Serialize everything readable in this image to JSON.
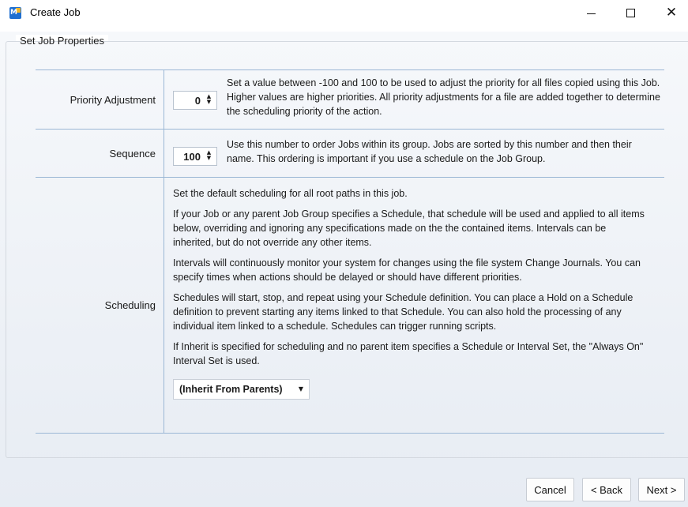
{
  "window": {
    "title": "Create Job",
    "minimize_symbol": "",
    "close_symbol": "✕"
  },
  "group": {
    "title": "Set Job Properties"
  },
  "properties": {
    "priority": {
      "label": "Priority Adjustment",
      "value": "0",
      "description": "Set a value between -100 and 100 to be used to adjust the priority for all files copied using this Job. Higher values are higher priorities. All priority adjustments for a file are added together to determine the scheduling priority of the action."
    },
    "sequence": {
      "label": "Sequence",
      "value": "100",
      "description": "Use this number to order Jobs within its group. Jobs are sorted by this number and then their name. This ordering is important if you use a schedule on the Job Group."
    },
    "scheduling": {
      "label": "Scheduling",
      "paragraphs": [
        "Set the default scheduling for all root paths in this job.",
        "If your Job or any parent Job Group specifies a Schedule, that schedule will be used and applied to all items below, overriding and ignoring any specifications made on the the contained items. Intervals can be inherited, but do not override any other items.",
        "Intervals will continuously monitor your system for changes using the file system Change Journals. You can specify times when actions should be delayed or should have different priorities.",
        "Schedules will start, stop, and repeat using your Schedule definition. You can place a Hold on a Schedule definition to prevent starting any items linked to that Schedule. You can also hold the processing of any individual item linked to a schedule. Schedules can trigger running scripts.",
        "If Inherit is specified for scheduling and no parent item specifies a Schedule or Interval Set, the \"Always On\" Interval Set is used."
      ],
      "selected": "(Inherit From Parents)"
    }
  },
  "buttons": {
    "cancel": "Cancel",
    "back": "< Back",
    "next": "Next >"
  },
  "colors": {
    "accent": "#1f6fd1",
    "grid_line": "#9bb7d5"
  }
}
